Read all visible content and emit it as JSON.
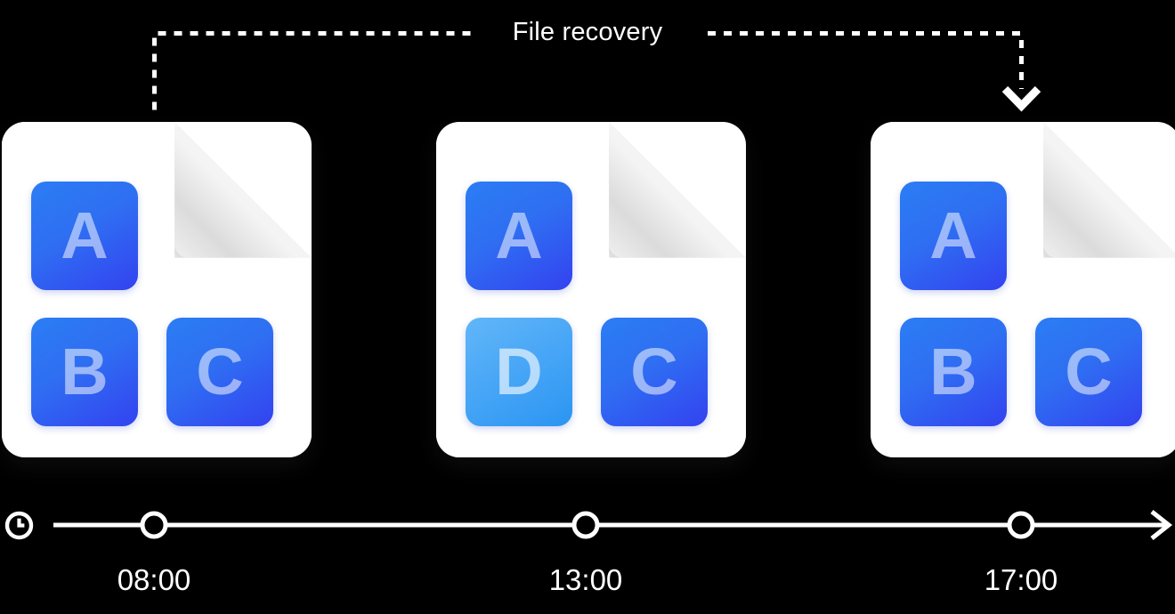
{
  "background_color": "#000000",
  "annotation": {
    "label": "File recovery",
    "label_color": "#ffffff",
    "line_style": "dashed",
    "line_color": "#ffffff",
    "from_node": "08:00",
    "to_node": "17:00",
    "arrow_direction": "down"
  },
  "files": [
    {
      "id": "file-snapshot-0800",
      "time": "08:00",
      "tiles": [
        {
          "slot": "a",
          "letter": "A",
          "variant": "normal"
        },
        {
          "slot": "b",
          "letter": "B",
          "variant": "normal"
        },
        {
          "slot": "c",
          "letter": "C",
          "variant": "normal"
        }
      ]
    },
    {
      "id": "file-snapshot-1300",
      "time": "13:00",
      "tiles": [
        {
          "slot": "a",
          "letter": "A",
          "variant": "normal"
        },
        {
          "slot": "b",
          "letter": "D",
          "variant": "light"
        },
        {
          "slot": "c",
          "letter": "C",
          "variant": "normal"
        }
      ]
    },
    {
      "id": "file-snapshot-1700",
      "time": "17:00",
      "tiles": [
        {
          "slot": "a",
          "letter": "A",
          "variant": "normal"
        },
        {
          "slot": "b",
          "letter": "B",
          "variant": "normal"
        },
        {
          "slot": "c",
          "letter": "C",
          "variant": "normal"
        }
      ]
    }
  ],
  "timeline": {
    "icon": "clock-icon",
    "axis_color": "#ffffff",
    "arrow_direction": "right",
    "nodes": [
      {
        "label": "08:00"
      },
      {
        "label": "13:00"
      },
      {
        "label": "17:00"
      }
    ]
  },
  "colors": {
    "card": "#ffffff",
    "fold": "#f4f4f4",
    "tile_gradient_start": "#2b7df4",
    "tile_gradient_end": "#3342f0",
    "tile_light_gradient_start": "#62b6f8",
    "tile_light_gradient_end": "#2b95f2",
    "letter": "rgba(255,255,255,0.52)",
    "accent_white": "#ffffff"
  }
}
